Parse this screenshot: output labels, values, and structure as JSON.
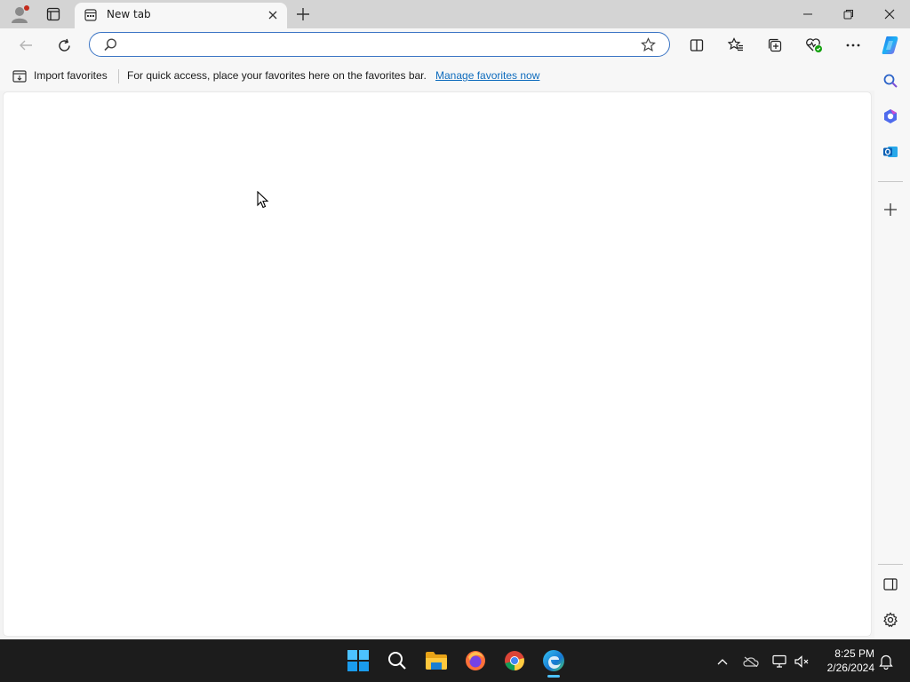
{
  "browser": {
    "tab": {
      "title": "New tab"
    },
    "address_bar": {
      "value": "",
      "placeholder": ""
    },
    "favorites_bar": {
      "import_label": "Import favorites",
      "message": "For quick access, place your favorites here on the favorites bar.",
      "manage_link": "Manage favorites now"
    },
    "icons": {
      "profile": "profile-icon",
      "tab_actions": "tab-actions-icon",
      "new_tab": "plus-icon",
      "back": "back-arrow-icon",
      "refresh": "refresh-icon",
      "search": "search-icon",
      "favorite_star": "star-icon",
      "split_screen": "split-screen-icon",
      "favorites": "favorites-icon",
      "collections": "collections-icon",
      "browser_essentials": "heart-pulse-icon",
      "more": "more-icon",
      "copilot": "copilot-icon"
    }
  },
  "sidebar": {
    "items": [
      "search-icon",
      "copilot-icon",
      "outlook-icon",
      "add-icon"
    ],
    "bottom": [
      "sidebar-toggle-icon",
      "settings-icon"
    ]
  },
  "taskbar": {
    "apps": [
      "windows-start-icon",
      "search-icon",
      "file-explorer-icon",
      "firefox-icon",
      "chrome-icon",
      "edge-icon"
    ],
    "tray": [
      "chevron-up-icon",
      "onedrive-icon",
      "network-icon",
      "volume-muted-icon",
      "notification-icon"
    ],
    "time": "8:25 PM",
    "date": "2/26/2024"
  },
  "colors": {
    "accent": "#3a74c4",
    "link": "#0f6cbd",
    "taskbar": "#1c1c1c",
    "titlebar": "#d4d4d4"
  }
}
